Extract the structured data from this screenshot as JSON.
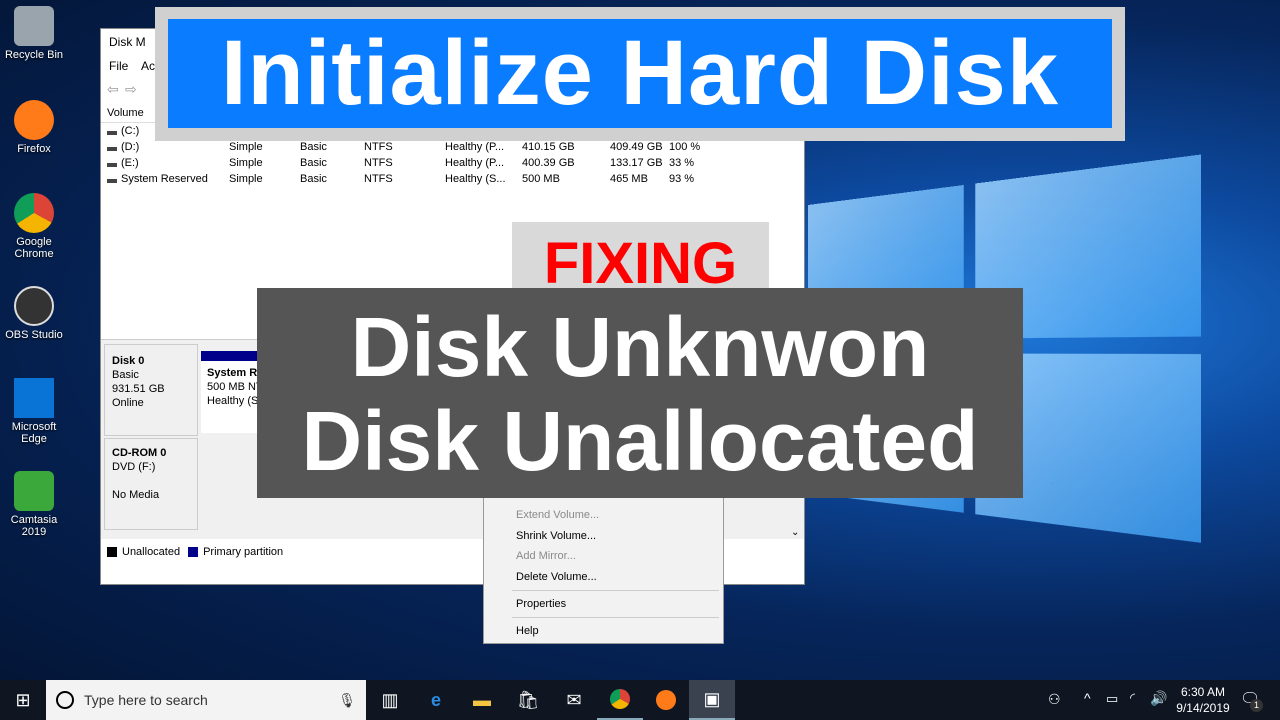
{
  "desktop_icons": [
    {
      "label": "Recycle Bin",
      "color": "#9aa4ad"
    },
    {
      "label": "Firefox",
      "color": "#ff7b1a"
    },
    {
      "label": "Google Chrome",
      "color": "#2ea043"
    },
    {
      "label": "OBS Studio",
      "color": "#333333"
    },
    {
      "label": "Microsoft Edge",
      "color": "#0a74d6"
    },
    {
      "label": "Camtasia 2019",
      "color": "#3aa83a"
    }
  ],
  "window": {
    "title": "Disk M",
    "menu": [
      "File",
      "Ac"
    ],
    "column_header": "Volume",
    "volumes": [
      {
        "name": "(C:)",
        "layout": "",
        "type": "",
        "fs": "",
        "status": "",
        "capacity": "",
        "free": "",
        "pct": ""
      },
      {
        "name": "(D:)",
        "layout": "Simple",
        "type": "Basic",
        "fs": "NTFS",
        "status": "Healthy (P...",
        "capacity": "410.15 GB",
        "free": "409.49 GB",
        "pct": "100 %"
      },
      {
        "name": "(E:)",
        "layout": "Simple",
        "type": "Basic",
        "fs": "NTFS",
        "status": "Healthy (P...",
        "capacity": "400.39 GB",
        "free": "133.17 GB",
        "pct": "33 %"
      },
      {
        "name": "System Reserved",
        "layout": "Simple",
        "type": "Basic",
        "fs": "NTFS",
        "status": "Healthy (S...",
        "capacity": "500 MB",
        "free": "465 MB",
        "pct": "93 %"
      }
    ],
    "disk0": {
      "name": "Disk 0",
      "type": "Basic",
      "size": "931.51 GB",
      "state": "Online",
      "partition_name": "System Re",
      "partition_size": "500 MB NT",
      "partition_status": "Healthy (S"
    },
    "cdrom": {
      "name": "CD-ROM 0",
      "drive": "DVD (F:)",
      "media": "No Media"
    },
    "legend": [
      {
        "label": "Unallocated",
        "color": "#000000"
      },
      {
        "label": "Primary partition",
        "color": "#00008b"
      }
    ]
  },
  "context_menu": [
    {
      "label": "Extend Volume...",
      "enabled": false
    },
    {
      "label": "Shrink Volume...",
      "enabled": true
    },
    {
      "label": "Add Mirror...",
      "enabled": false
    },
    {
      "label": "Delete Volume...",
      "enabled": true
    },
    {
      "label": "Properties",
      "enabled": true
    },
    {
      "label": "Help",
      "enabled": true
    }
  ],
  "overlay": {
    "title": "Initialize Hard Disk",
    "fixing": "FIXING",
    "line1": "Disk Unknwon",
    "line2": "Disk Unallocated",
    "title_bg": "#0a7cff",
    "fixing_color": "#ff0000"
  },
  "taskbar": {
    "search_placeholder": "Type here to search",
    "time": "6:30 AM",
    "date": "9/14/2019",
    "notifications": "1"
  }
}
